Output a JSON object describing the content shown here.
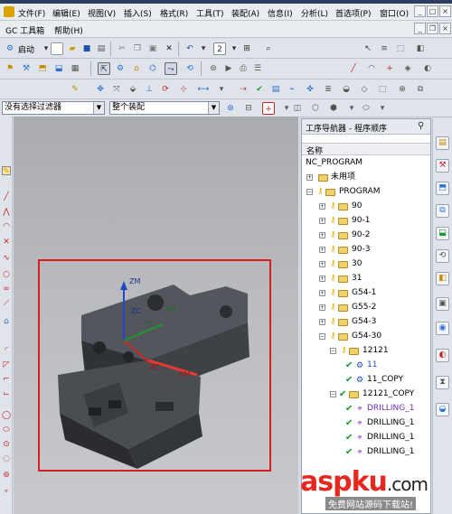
{
  "menubar": {
    "items": [
      "文件(F)",
      "编辑(E)",
      "视图(V)",
      "插入(S)",
      "格式(R)",
      "工具(T)",
      "装配(A)",
      "信息(I)",
      "分析(L)",
      "首选项(P)",
      "窗口(O)"
    ],
    "window_min": "_",
    "window_max": "□",
    "window_close": "×"
  },
  "gcbar": {
    "items": [
      "GC 工具箱",
      "帮助(H)"
    ]
  },
  "toolbar": {
    "start_label": "启动"
  },
  "filter": {
    "selection_filter": "没有选择过滤器",
    "assembly_scope": "整个装配"
  },
  "navigator": {
    "title": "工序导航器 - 程序顺序",
    "pin_icon": "pin-icon",
    "column_header": "名称",
    "rows": [
      {
        "label": "NC_PROGRAM",
        "level": 0
      },
      {
        "label": "未用项",
        "level": 1
      },
      {
        "label": "PROGRAM",
        "level": 1
      },
      {
        "label": "90",
        "level": 2
      },
      {
        "label": "90-1",
        "level": 2
      },
      {
        "label": "90-2",
        "level": 2
      },
      {
        "label": "90-3",
        "level": 2
      },
      {
        "label": "30",
        "level": 2
      },
      {
        "label": "31",
        "level": 2
      },
      {
        "label": "G54-1",
        "level": 2
      },
      {
        "label": "G55-2",
        "level": 2
      },
      {
        "label": "G54-3",
        "level": 2
      },
      {
        "label": "G54-30",
        "level": 2
      },
      {
        "label": "12121",
        "level": 3
      },
      {
        "label": "11",
        "level": 4
      },
      {
        "label": "11_COPY",
        "level": 4
      },
      {
        "label": "12121_COPY",
        "level": 3
      },
      {
        "label": "DRILLING_1",
        "level": 4
      },
      {
        "label": "DRILLING_1",
        "level": 4
      },
      {
        "label": "DRILLING_1",
        "level": 4
      },
      {
        "label": "DRILLING_1",
        "level": 4
      }
    ]
  },
  "viewport": {
    "axis_labels": [
      "ZM",
      "ZC",
      "YC",
      "YM",
      "XC",
      "XM"
    ],
    "selection_color": "#d32020"
  },
  "watermark": {
    "brand": "aspku",
    "suffix": ".com",
    "tagline": "免费网站源码下载站!"
  },
  "colors": {
    "accent_check": "#1a9a2a",
    "drilling_text": "#6b2bb8",
    "selected_op_text": "#2146c7"
  }
}
